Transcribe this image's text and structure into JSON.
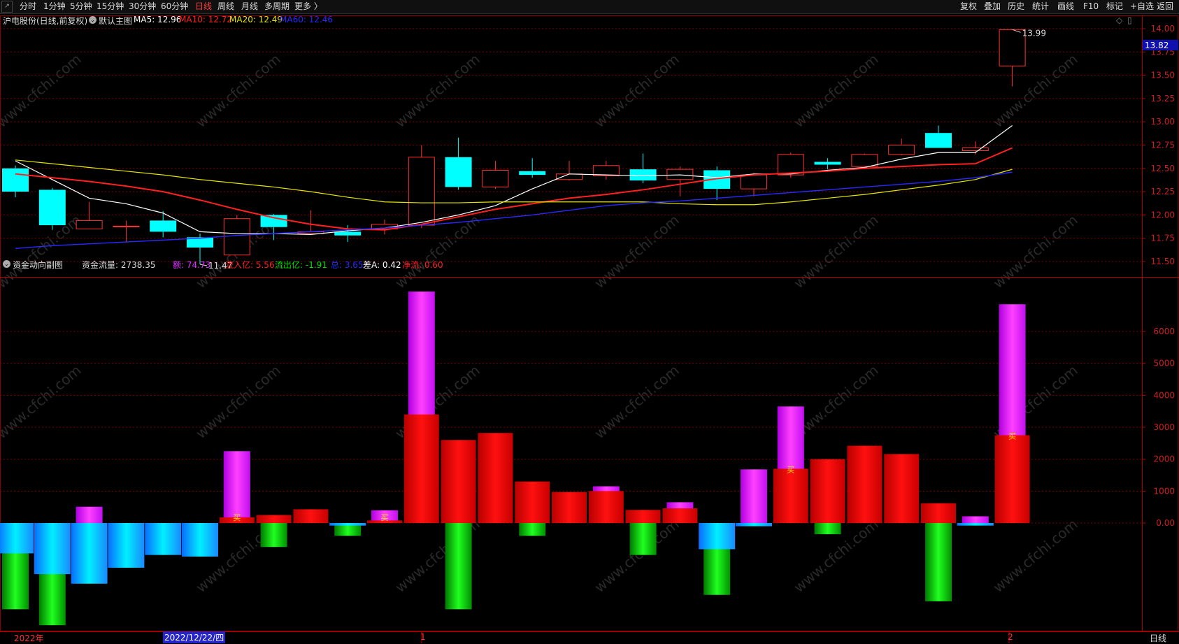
{
  "toolbar": {
    "left_items": [
      "分时",
      "1分钟",
      "5分钟",
      "15分钟",
      "30分钟",
      "60分钟",
      "日线",
      "周线",
      "月线",
      "多周期",
      "更多 〉"
    ],
    "active": "日线",
    "right_items": [
      "复权",
      "叠加",
      "历史",
      "统计",
      "画线",
      "F10",
      "标记",
      "+自选",
      "返回"
    ]
  },
  "main_info": {
    "stock": "沪电股份(日线,前复权)",
    "chart_name": "默认主图",
    "ma5": "MA5: 12.96",
    "ma10": "MA10: 12.72",
    "ma20": "MA20: 12.49",
    "ma60": "MA60: 12.46",
    "high_label": "13.99",
    "low_label": "11.47",
    "price_tag": "13.82"
  },
  "sub_info": {
    "chart_name": "资金动向副图",
    "flow": "资金流量: 2738.35",
    "amount": "额: 74.73",
    "inflow": "流入亿: 5.56",
    "outflow": "流出亿: -1.91",
    "total": "总: 3.65",
    "diff": "差A: 0.42",
    "net": "净流: 0.60"
  },
  "price_axis": [
    "14.00",
    "13.75",
    "13.50",
    "13.25",
    "13.00",
    "12.75",
    "12.50",
    "12.25",
    "12.00",
    "11.75",
    "11.50"
  ],
  "sub_axis": [
    "6000",
    "5000",
    "4000",
    "3000",
    "2000",
    "1000",
    "0.00"
  ],
  "bottom": {
    "year": "2022年",
    "cursor_date": "2022/12/22/四",
    "month1": "1",
    "month2": "2",
    "period": "日线"
  },
  "buy_label": "买",
  "watermark": "www.cfchi.com",
  "colors": {
    "up": "#ff3333",
    "down": "#00ffff",
    "ma5": "#ffffff",
    "ma10": "#ff2020",
    "ma20": "#e6e600",
    "ma60": "#2a2aff",
    "magenta": "#e030ff",
    "green": "#00e000",
    "grid": "#7a0000"
  },
  "chart_data": {
    "type": "candlestick",
    "candles": [
      {
        "o": 12.5,
        "c": 12.25,
        "h": 12.53,
        "l": 12.19
      },
      {
        "o": 12.27,
        "c": 11.89,
        "h": 12.29,
        "l": 11.84
      },
      {
        "o": 11.85,
        "c": 11.94,
        "h": 12.14,
        "l": 11.85
      },
      {
        "o": 11.88,
        "c": 11.88,
        "h": 11.94,
        "l": 11.71
      },
      {
        "o": 11.94,
        "c": 11.82,
        "h": 12.04,
        "l": 11.76
      },
      {
        "o": 11.76,
        "c": 11.65,
        "h": 11.8,
        "l": 11.47
      },
      {
        "o": 11.57,
        "c": 11.96,
        "h": 12.0,
        "l": 11.57
      },
      {
        "o": 12.0,
        "c": 11.87,
        "h": 12.01,
        "l": 11.73
      },
      {
        "o": 11.8,
        "c": 11.82,
        "h": 12.05,
        "l": 11.79
      },
      {
        "o": 11.82,
        "c": 11.78,
        "h": 11.89,
        "l": 11.71
      },
      {
        "o": 11.85,
        "c": 11.9,
        "h": 11.95,
        "l": 11.79
      },
      {
        "o": 11.89,
        "c": 12.62,
        "h": 12.75,
        "l": 11.86
      },
      {
        "o": 12.62,
        "c": 12.3,
        "h": 12.83,
        "l": 12.27
      },
      {
        "o": 12.3,
        "c": 12.48,
        "h": 12.58,
        "l": 12.28
      },
      {
        "o": 12.47,
        "c": 12.43,
        "h": 12.61,
        "l": 12.4
      },
      {
        "o": 12.38,
        "c": 12.44,
        "h": 12.58,
        "l": 12.37
      },
      {
        "o": 12.42,
        "c": 12.53,
        "h": 12.58,
        "l": 12.38
      },
      {
        "o": 12.49,
        "c": 12.37,
        "h": 12.66,
        "l": 12.34
      },
      {
        "o": 12.38,
        "c": 12.49,
        "h": 12.52,
        "l": 12.2
      },
      {
        "o": 12.48,
        "c": 12.28,
        "h": 12.52,
        "l": 12.16
      },
      {
        "o": 12.28,
        "c": 12.43,
        "h": 12.45,
        "l": 12.2
      },
      {
        "o": 12.43,
        "c": 12.65,
        "h": 12.67,
        "l": 12.4
      },
      {
        "o": 12.57,
        "c": 12.54,
        "h": 12.61,
        "l": 12.49
      },
      {
        "o": 12.52,
        "c": 12.65,
        "h": 12.66,
        "l": 12.49
      },
      {
        "o": 12.65,
        "c": 12.75,
        "h": 12.82,
        "l": 12.64
      },
      {
        "o": 12.88,
        "c": 12.72,
        "h": 12.96,
        "l": 12.72
      },
      {
        "o": 12.69,
        "c": 12.72,
        "h": 12.79,
        "l": 12.65
      },
      {
        "o": 13.6,
        "c": 13.99,
        "h": 13.99,
        "l": 13.38
      }
    ],
    "ma": {
      "MA5": [
        12.58,
        12.38,
        12.18,
        12.12,
        12.02,
        11.82,
        11.8,
        11.8,
        11.79,
        11.83,
        11.86,
        11.92,
        12.0,
        12.1,
        12.28,
        12.44,
        12.43,
        12.42,
        12.43,
        12.4,
        12.44,
        12.44,
        12.48,
        12.51,
        12.6,
        12.67,
        12.67,
        12.96
      ],
      "MA10": [
        12.44,
        12.4,
        12.36,
        12.31,
        12.25,
        12.16,
        12.06,
        11.97,
        11.9,
        11.85,
        11.84,
        11.9,
        11.98,
        12.06,
        12.12,
        12.18,
        12.22,
        12.27,
        12.33,
        12.39,
        12.43,
        12.45,
        12.47,
        12.5,
        12.52,
        12.54,
        12.55,
        12.72
      ],
      "MA20": [
        12.59,
        12.55,
        12.51,
        12.47,
        12.43,
        12.38,
        12.34,
        12.3,
        12.25,
        12.19,
        12.14,
        12.13,
        12.13,
        12.14,
        12.14,
        12.14,
        12.14,
        12.14,
        12.12,
        12.11,
        12.11,
        12.14,
        12.18,
        12.22,
        12.27,
        12.32,
        12.38,
        12.49
      ],
      "MA60": [
        11.64,
        11.67,
        11.69,
        11.71,
        11.73,
        11.75,
        11.78,
        11.8,
        11.82,
        11.84,
        11.86,
        11.89,
        11.92,
        11.96,
        12.0,
        12.05,
        12.1,
        12.13,
        12.15,
        12.18,
        12.21,
        12.24,
        12.27,
        12.3,
        12.33,
        12.36,
        12.4,
        12.46
      ]
    },
    "ylim": [
      11.43,
      14.05
    ],
    "sub_ylim": [
      -3300,
      7300
    ],
    "fund": {
      "magenta": [
        0,
        0,
        510,
        0,
        0,
        0,
        2250,
        0,
        0,
        0,
        400,
        7250,
        0,
        0,
        0,
        0,
        1150,
        0,
        650,
        0,
        1680,
        3650,
        0,
        0,
        0,
        0,
        210,
        6850
      ],
      "red": [
        0,
        0,
        0,
        0,
        0,
        0,
        180,
        250,
        430,
        0,
        80,
        3400,
        2600,
        2820,
        1300,
        970,
        1000,
        410,
        460,
        0,
        0,
        1700,
        2000,
        2420,
        2160,
        620,
        0,
        2750
      ],
      "cyan": [
        -950,
        -1600,
        -1900,
        -1400,
        -1000,
        -1050,
        0,
        0,
        0,
        -80,
        0,
        0,
        0,
        0,
        0,
        0,
        0,
        0,
        0,
        -820,
        -100,
        0,
        0,
        0,
        0,
        0,
        -80,
        0
      ],
      "green": [
        -2700,
        -3200,
        0,
        0,
        0,
        0,
        0,
        -750,
        0,
        -400,
        0,
        0,
        -2700,
        0,
        -400,
        0,
        0,
        -1000,
        0,
        -2250,
        0,
        0,
        -350,
        0,
        0,
        -2450,
        0,
        0
      ],
      "buy": [
        6,
        10,
        21,
        27
      ]
    }
  }
}
